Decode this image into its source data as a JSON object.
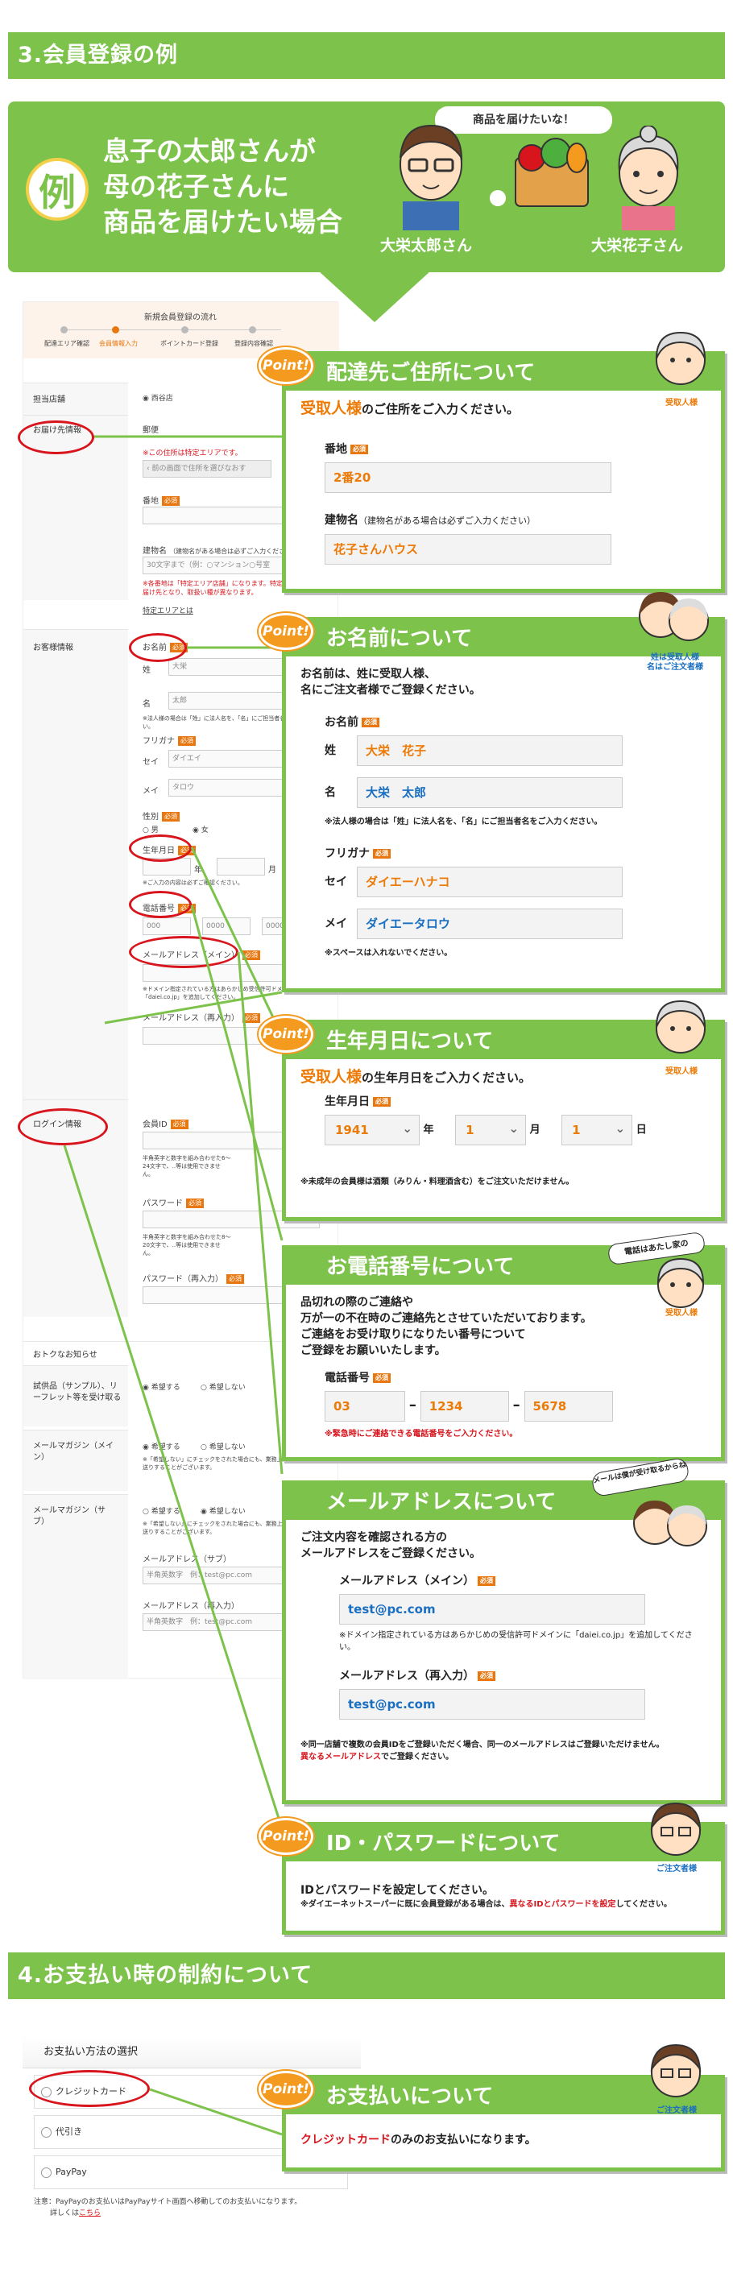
{
  "section3": {
    "title": "3.会員登録の例"
  },
  "banner": {
    "rei": "例",
    "line1": "息子の太郎さんが",
    "line2": "母の花子さんに",
    "line3": "商品を届けたい場合",
    "bubble": "商品を届けたいな！",
    "son": "大栄太郎さん",
    "mother": "大栄花子さん"
  },
  "form": {
    "flow_title": "新規会員登録の流れ",
    "steps": [
      "配達エリア確認",
      "会員情報入力",
      "ポイントカード登録",
      "登録内容確認"
    ],
    "store_label": "担当店舗",
    "store_value": "西谷店",
    "delivery_label": "お届け先情報",
    "postal": "郵便",
    "area_note": "※この住所は特定エリアです。",
    "back_btn": "前の画面で住所を選びなおす",
    "banchi": "番地",
    "building": "建物名",
    "building_note": "（建物名がある場合は必ずご入力ください）",
    "building_ph": "30文字まで（例：○マンション○号室",
    "building_warn": "※各番地は「特定エリア店舗」になります。特定エリア店舗はお届け先となり、取扱い種が異なります。",
    "area_link": "特定エリアとは",
    "customer_label": "お客様情報",
    "name_label": "お名前",
    "sei": "姓",
    "sei_val": "大栄",
    "mei": "名",
    "mei_val": "太郎",
    "name_note": "※法人様の場合は「姓」に法人名を、「名」にご担当者名をご入力ください。",
    "kana_label": "フリガナ",
    "kana_sei": "セイ",
    "kana_sei_val": "ダイエイ",
    "kana_mei": "メイ",
    "kana_mei_val": "タロウ",
    "gender_label": "性別",
    "male": "男",
    "female": "女",
    "birth_label": "生年月日",
    "birth_note": "※ご入力の内容は必ずご確認ください。",
    "year": "年",
    "month": "月",
    "tel_label": "電話番号",
    "tel1": "000",
    "tel2": "0000",
    "tel3": "0000",
    "mail_label": "メールアドレス（メイン）",
    "mail_note": "※ドメイン指定されている方はあらかじめ受信許可ドメインに「daiei.co.jp」を追加してください。",
    "mail2_label": "メールアドレス（再入力）",
    "login_label": "ログイン情報",
    "id_label": "会員ID",
    "id_note": "半角英字と数字を組み合わせた6〜24文字で、..等は使用できません。",
    "pw_label": "パスワード",
    "pw_note": "半角英字と数字を組み合わせた8〜20文字で、..等は使用できません。",
    "pw2_label": "パスワード（再入力）",
    "otoku": "おトクなお知らせ",
    "sample_label": "試供品（サンプル）、リーフレット等を受け取る",
    "want": "希望する",
    "nowant": "希望しない",
    "mag_main": "メールマガジン（メイン）",
    "mag_note": "※「希望しない」にチェックをされた場合にも、業務上必要なメールはお送りすることがございます。",
    "mag_sub": "メールマガジン（サブ）",
    "mail_sub": "メールアドレス（サブ）",
    "mail_sub_ph": "半角英数字　例：test@pc.com",
    "mail_sub2": "メールアドレス（再入力）",
    "mail_sub2_ph": "半角英数字　例：test@pc.com",
    "required": "必須"
  },
  "c1": {
    "point": "Point!",
    "title": "配達先ご住所について",
    "lead_em": "受取人様",
    "lead": "のご住所をご入力ください。",
    "banchi": "番地",
    "banchi_val": "2番20",
    "building": "建物名",
    "building_note": "（建物名がある場合は必ずご入力ください）",
    "building_val": "花子さんハウス",
    "face": "受取人様"
  },
  "c2": {
    "title": "お名前について",
    "lead1": "お名前は、姓に受取人様、",
    "lead2": "名にご注文者様でご登録ください。",
    "name": "お名前",
    "sei": "姓",
    "sei_val": "大栄　花子",
    "mei": "名",
    "mei_val": "大栄　太郎",
    "note": "※法人様の場合は「姓」に法人名を、「名」にご担当者名をご入力ください。",
    "kana": "フリガナ",
    "kana_sei": "セイ",
    "kana_sei_val": "ダイエーハナコ",
    "kana_mei": "メイ",
    "kana_mei_val": "ダイエータロウ",
    "space": "※スペースは入れないでください。",
    "face1": "姓は受取人様",
    "face2": "名はご注文者様"
  },
  "c3": {
    "title": "生年月日について",
    "lead_em": "受取人様",
    "lead": "の生年月日をご入力ください。",
    "label": "生年月日",
    "year_val": "1941",
    "year": "年",
    "month_val": "1",
    "month": "月",
    "day_val": "1",
    "day": "日",
    "note": "※未成年の会員様は酒類（みりん・料理酒含む）をご注文いただけません。",
    "face": "受取人様"
  },
  "c4": {
    "title": "お電話番号について",
    "bubble": "電話はあたし家の",
    "lead1": "品切れの際のご連絡や",
    "lead2": "万が一の不在時のご連絡先とさせていただいております。",
    "lead3": "ご連絡をお受け取りになりたい番号について",
    "lead4": "ご登録をお願いいたします。",
    "label": "電話番号",
    "t1": "03",
    "t2": "1234",
    "t3": "5678",
    "note": "※緊急時にご連絡できる電話番号をご入力ください。",
    "face": "受取人様"
  },
  "c5": {
    "title": "メールアドレスについて",
    "bubble": "メールは僕が受け取るからね",
    "lead1": "ご注文内容を確認される方の",
    "lead2": "メールアドレスをご登録ください。",
    "main": "メールアドレス（メイン）",
    "main_val": "test@pc.com",
    "domain_note": "※ドメイン指定されている方はあらかじめの受信許可ドメインに「daiei.co.jp」を追加してください。",
    "re": "メールアドレス（再入力）",
    "re_val": "test@pc.com",
    "note1": "※同一店舗で複数の会員IDをご登録いただく場合、同一のメールアドレスはご登録いただけません。",
    "note2": "異なるメールアドレス",
    "note3": "でご登録ください。"
  },
  "c6": {
    "title": "ID・パスワードについて",
    "lead": "IDとパスワードを設定してください。",
    "note1": "※ダイエーネットスーパーに既に会員登録がある場合は、",
    "note2": "異なるIDとパスワードを設定",
    "note3": "してください。",
    "face": "ご注文者様"
  },
  "section4": {
    "title": "4.お支払い時の制約について"
  },
  "pay": {
    "title": "お支払い方法の選択",
    "credit": "クレジットカード",
    "cod": "代引き",
    "paypay": "PayPay",
    "note": "注意：PayPayのお支払いはPayPayサイト画面へ移動してのお支払いになります。",
    "more": "詳しくは",
    "link": "こちら"
  },
  "c7": {
    "title": "お支払いについて",
    "em": "クレジットカード",
    "lead": "のみのお支払いになります。",
    "face": "ご注文者様"
  }
}
